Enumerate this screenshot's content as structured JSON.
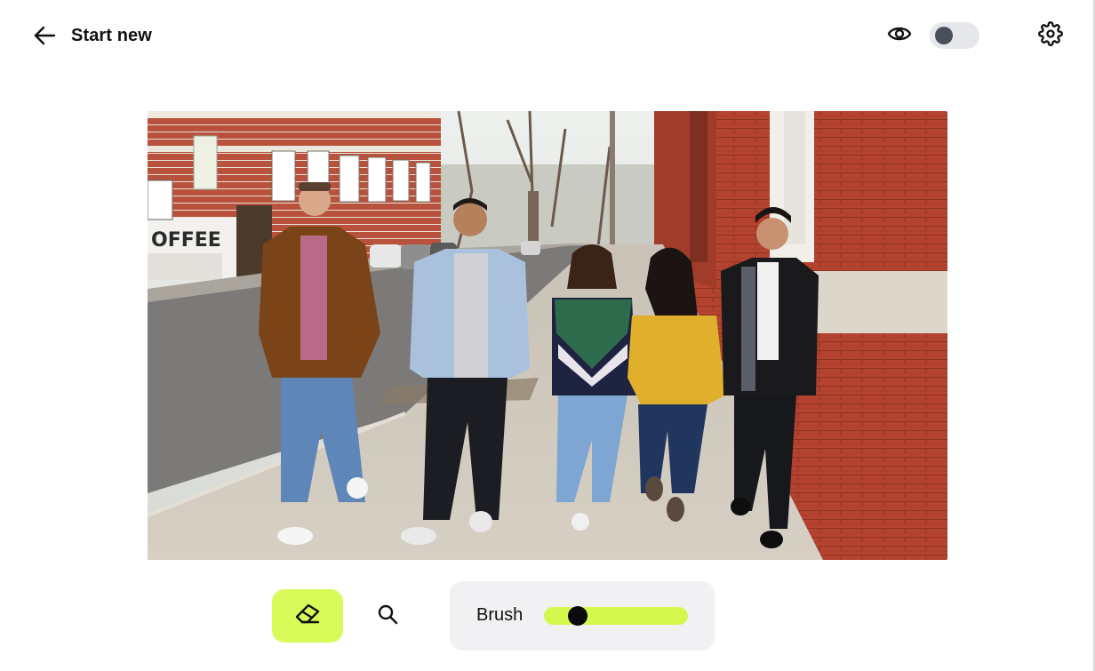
{
  "header": {
    "back_label": "Start new",
    "back_icon": "arrow-left-icon",
    "preview_icon": "eye-icon",
    "settings_icon": "gear-icon",
    "compare_toggle_on": false
  },
  "canvas": {
    "image": "photo-of-five-people-walking-on-sidewalk"
  },
  "toolbar": {
    "eraser_icon": "eraser-icon",
    "zoom_icon": "search-icon",
    "brush_label": "Brush",
    "brush_size": 0.19,
    "accent_color": "#d8fb5a"
  }
}
